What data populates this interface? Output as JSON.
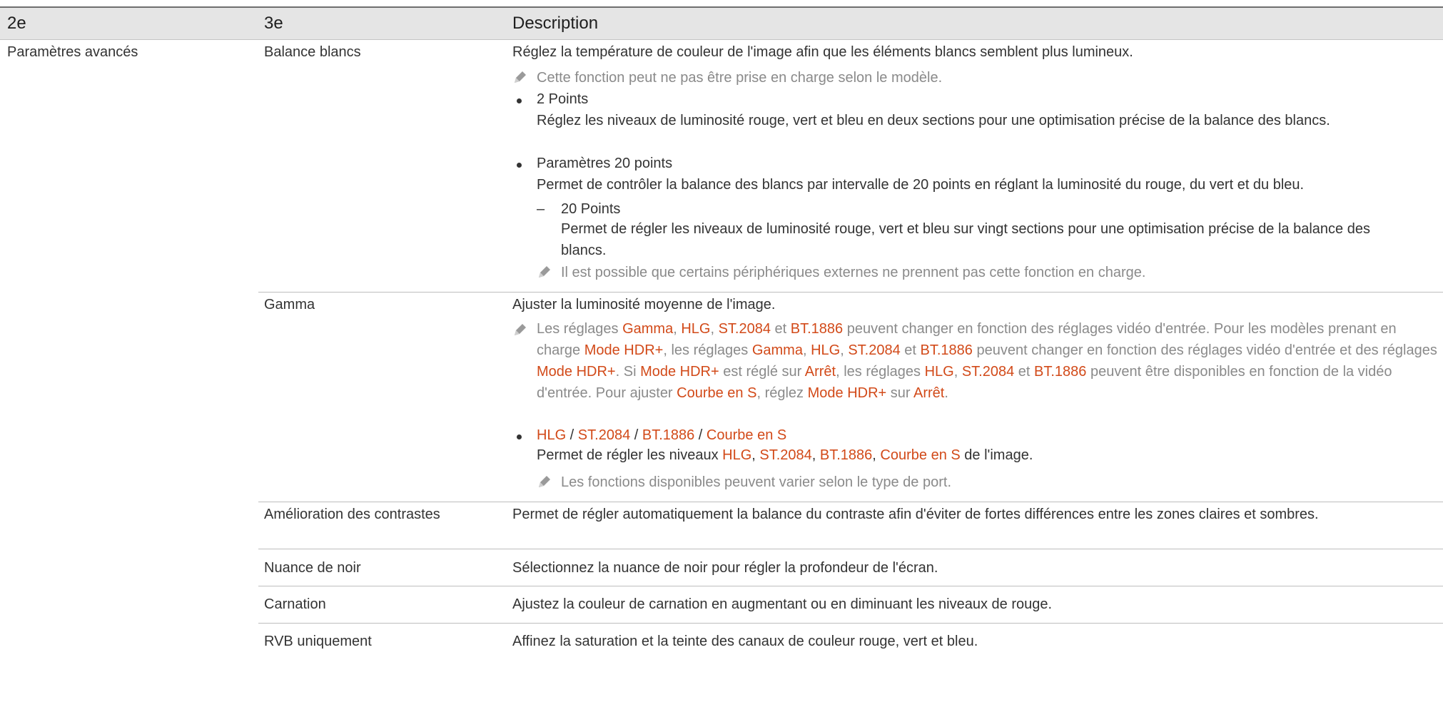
{
  "header": {
    "col1": "2e",
    "col2": "3e",
    "col3": "Description"
  },
  "section": "Paramètres avancés",
  "rows": {
    "balance": {
      "label": "Balance blancs",
      "desc": "Réglez la température de couleur de l'image afin que les éléments blancs semblent plus lumineux.",
      "note": "Cette fonction peut ne pas être prise en charge selon le modèle.",
      "b1_title": "2 Points",
      "b1_desc": "Réglez les niveaux de luminosité rouge, vert et bleu en deux sections pour une optimisation précise de la balance des blancs.",
      "b2_title": "Paramètres 20 points",
      "b2_desc": "Permet de contrôler la balance des blancs par intervalle de 20 points en réglant la luminosité du rouge, du vert et du bleu.",
      "sub_title": "20 Points",
      "sub_desc": "Permet de régler les niveaux de luminosité rouge, vert et bleu sur vingt sections pour une optimisation précise de la balance des blancs.",
      "note2": "Il est possible que certains périphériques externes ne prennent pas cette fonction en charge."
    },
    "gamma": {
      "label": "Gamma",
      "desc": "Ajuster la luminosité moyenne de l'image.",
      "note": {
        "t1": "Les réglages ",
        "h1": "Gamma",
        "t2": ", ",
        "h2": "HLG",
        "t3": ", ",
        "h3": "ST.2084",
        "t4": " et ",
        "h4": "BT.1886",
        "t5": " peuvent changer en fonction des réglages vidéo d'entrée. Pour les modèles prenant en charge ",
        "h5": "Mode HDR+",
        "t6": ", les réglages ",
        "h6": "Gamma",
        "t7": ", ",
        "h7": "HLG",
        "t8": ", ",
        "h8": "ST.2084",
        "t9": " et ",
        "h9": "BT.1886",
        "t10": " peuvent changer en fonction des réglages vidéo d'entrée et des réglages ",
        "h10": "Mode HDR+",
        "t11": ". Si ",
        "h11": "Mode HDR+",
        "t12": " est réglé sur ",
        "h12": "Arrêt",
        "t13": ", les réglages ",
        "h13": "HLG",
        "t14": ", ",
        "h14": "ST.2084",
        "t15": " et ",
        "h15": "BT.1886",
        "t16": " peuvent être disponibles en fonction de la vidéo d'entrée. Pour ajuster ",
        "h16": "Courbe en S",
        "t17": ", réglez ",
        "h17": "Mode HDR+",
        "t18": " sur ",
        "h18": "Arrêt",
        "t19": "."
      },
      "b_title": {
        "h1": "HLG",
        "s1": " / ",
        "h2": "ST.2084",
        "s2": " / ",
        "h3": "BT.1886",
        "s3": " / ",
        "h4": "Courbe en S"
      },
      "b_desc": {
        "t1": "Permet de régler les niveaux ",
        "h1": "HLG",
        "t2": ", ",
        "h2": "ST.2084",
        "t3": ", ",
        "h3": "BT.1886",
        "t4": ", ",
        "h4": "Courbe en S",
        "t5": " de l'image."
      },
      "note2": "Les fonctions disponibles peuvent varier selon le type de port."
    },
    "contrast": {
      "label": "Amélioration des contrastes",
      "desc": "Permet de régler automatiquement la balance du contraste afin d'éviter de fortes différences entre les zones claires et sombres."
    },
    "noir": {
      "label": "Nuance de noir",
      "desc": "Sélectionnez la nuance de noir pour régler la profondeur de l'écran."
    },
    "carnation": {
      "label": "Carnation",
      "desc": "Ajustez la couleur de carnation en augmentant ou en diminuant les niveaux de rouge."
    },
    "rvb": {
      "label": "RVB uniquement",
      "desc": "Affinez la saturation et la teinte des canaux de couleur rouge, vert et bleu."
    }
  },
  "colors": {
    "accent": "#d24a19",
    "header_bg": "#e5e5e5",
    "text": "#333333",
    "note": "#8a8a8a"
  }
}
